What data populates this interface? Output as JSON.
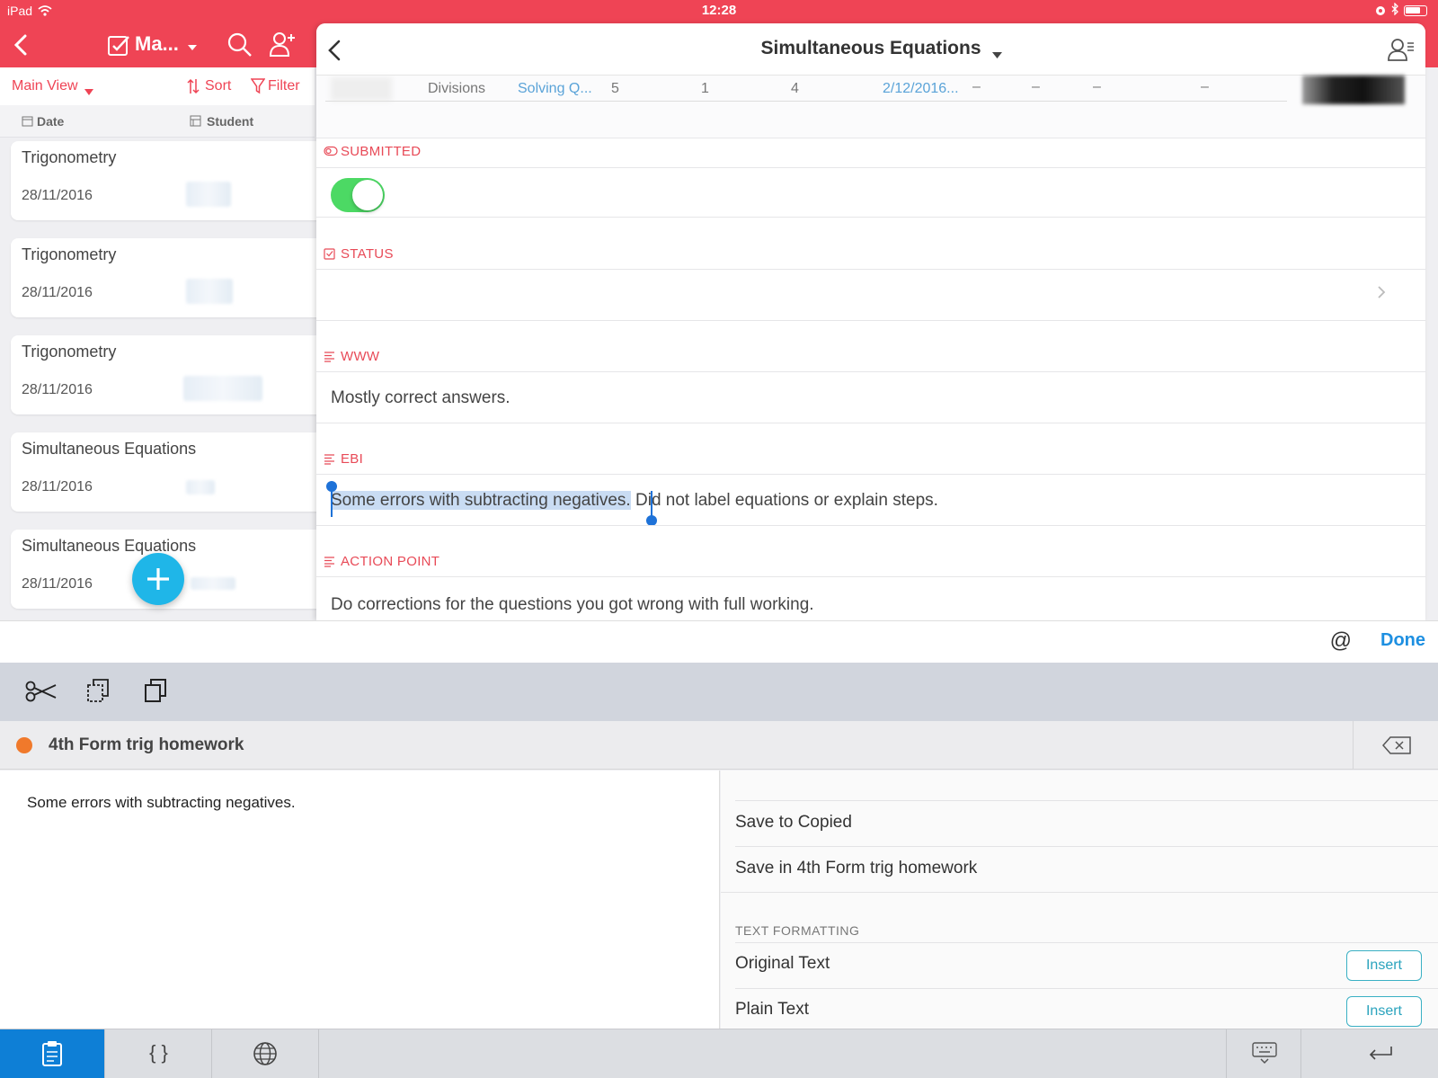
{
  "status_bar": {
    "device": "iPad",
    "time": "12:28"
  },
  "left_nav": {
    "title": "Ma...",
    "view_label": "Main View",
    "sort_label": "Sort",
    "filter_label": "Filter"
  },
  "left_columns": {
    "date": "Date",
    "student": "Student"
  },
  "records": [
    {
      "title": "Trigonometry",
      "date": "28/11/2016"
    },
    {
      "title": "Trigonometry",
      "date": "28/11/2016"
    },
    {
      "title": "Trigonometry",
      "date": "28/11/2016"
    },
    {
      "title": "Simultaneous Equations",
      "date": "28/11/2016"
    },
    {
      "title": "Simultaneous Equations",
      "date": "28/11/2016"
    }
  ],
  "detail": {
    "title": "Simultaneous Equations",
    "row": {
      "divisions": "Divisions",
      "topic": "Solving Q...",
      "n1": "5",
      "n2": "1",
      "n3": "4",
      "date": "2/12/2016..."
    },
    "submitted_label": "SUBMITTED",
    "submitted_value": true,
    "status_label": "STATUS",
    "www_label": "WWW",
    "www_value": "Mostly correct answers.",
    "ebi_label": "EBI",
    "ebi_selected": "Some errors with subtracting negatives.",
    "ebi_rest": " Did not label equations or explain steps.",
    "action_label": "ACTION POINT",
    "action_value": "Do corrections for the questions you got wrong with full working."
  },
  "edit_bar": {
    "at_symbol": "@",
    "done": "Done"
  },
  "clipboard": {
    "list_name": "4th Form trig homework",
    "list_color": "#f0792b",
    "clip_text": "Some errors with subtracting negatives.",
    "actions": [
      "Save to Copied",
      "Save in 4th Form trig homework"
    ],
    "formatting_header": "TEXT FORMATTING",
    "formatting": [
      {
        "label": "Original Text",
        "button": "Insert"
      },
      {
        "label": "Plain Text",
        "button": "Insert"
      }
    ]
  },
  "bottom_bar": {
    "braces": "{ }"
  },
  "colors": {
    "brand_red": "#ef4455",
    "accent_blue": "#1d8fe1",
    "fab": "#1fb6e8",
    "toggle_on": "#4cd964"
  }
}
